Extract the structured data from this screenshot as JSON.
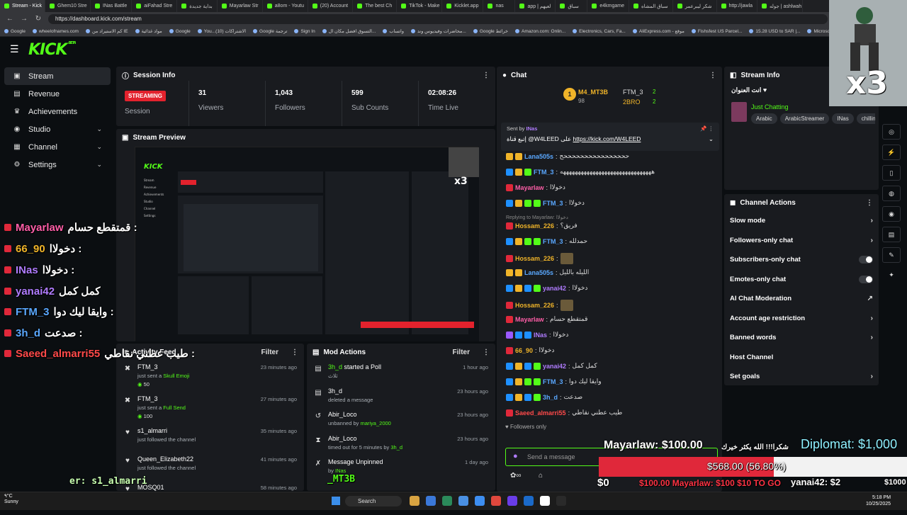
{
  "browser": {
    "tabs": [
      "Stream - Kick",
      "Ghem10 Stre",
      "INas Battle",
      "aiFahad Stre",
      "بداية جديدة",
      "Mayarlaw Str",
      "a8om - Youtu",
      "(20) Account",
      "The best Ch",
      "TikTok - Make",
      "Kicklet.app",
      "nas",
      "app | لعيهم",
      "سباق",
      "e4kmgame",
      "سباق المشاه",
      "شكر ليبرعمر",
      "http://jawla",
      "جوله | ashlwah"
    ],
    "url": "https://dashboard.kick.com/stream",
    "bookmarks": [
      "Google",
      "wheelofnames.com",
      "كم الاستيراد من IE",
      "مواد غذائية",
      "Google",
      "You...الاشتراكات (10)",
      "Google ترجمة",
      "Sign In",
      "التسوق افضل مكان ال...",
      "واتساب",
      "محاضرات وفيديوس وند...",
      "Google خرائط",
      "Amazon.com: Onlin...",
      "Electronics, Cars, Fa...",
      "AliExpress.com - موقع",
      "Fishsfest US Parcel...",
      "15.28 USD to SAR |...",
      "Microsoft Learning"
    ]
  },
  "kick": {
    "logo": "KICK",
    "logo_sup": "BETA",
    "sidebar": [
      {
        "label": "Stream",
        "icon": "▣",
        "expand": ""
      },
      {
        "label": "Revenue",
        "icon": "▤",
        "expand": ""
      },
      {
        "label": "Achievements",
        "icon": "♛",
        "expand": ""
      },
      {
        "label": "Studio",
        "icon": "◉",
        "expand": "⌄"
      },
      {
        "label": "Channel",
        "icon": "▦",
        "expand": "⌄"
      },
      {
        "label": "Settings",
        "icon": "⚙",
        "expand": "⌄"
      }
    ]
  },
  "session": {
    "title": "Session Info",
    "status": "STREAMING",
    "status_label": "Session",
    "stats": [
      {
        "value": "31",
        "label": "Viewers"
      },
      {
        "value": "1,043",
        "label": "Followers"
      },
      {
        "value": "599",
        "label": "Sub Counts"
      },
      {
        "value": "02:08:26",
        "label": "Time Live"
      }
    ]
  },
  "preview": {
    "title": "Stream Preview"
  },
  "activity": {
    "title": "Activity Feed",
    "filter": "Filter",
    "items": [
      {
        "name": "FTM_3",
        "text": "just sent a ",
        "hl": "Skull Emoji",
        "amount": "50",
        "time": "23 minutes ago",
        "icon": "✖"
      },
      {
        "name": "FTM_3",
        "text": "just sent a ",
        "hl": "Full Send",
        "amount": "100",
        "time": "27 minutes ago",
        "icon": "✖"
      },
      {
        "name": "s1_almarri",
        "text": "just followed the channel",
        "hl": "",
        "amount": "",
        "time": "35 minutes ago",
        "icon": "♥"
      },
      {
        "name": "Queen_Elizabeth22",
        "text": "just followed the channel",
        "hl": "",
        "amount": "",
        "time": "41 minutes ago",
        "icon": "♥"
      },
      {
        "name": "MOSQ01",
        "text": "",
        "hl": "",
        "amount": "",
        "time": "58 minutes ago",
        "icon": "♥"
      }
    ]
  },
  "mod": {
    "title": "Mod Actions",
    "filter": "Filter",
    "items": [
      {
        "name": "3h_d",
        "action": " started a Poll",
        "sub": "ثلاث",
        "by": "",
        "time": "1 hour ago",
        "icon": "▤"
      },
      {
        "name": "3h_d",
        "action": "",
        "sub": "deleted a message",
        "by": "",
        "time": "23 hours ago",
        "icon": "▤"
      },
      {
        "name": "Abir_Loco",
        "action": "",
        "sub": "unbanned by ",
        "by": "mariya_2000",
        "time": "23 hours ago",
        "icon": "↺"
      },
      {
        "name": "Abir_Loco",
        "action": "",
        "sub": "timed out for 5 minutes by ",
        "by": "3h_d",
        "time": "23 hours ago",
        "icon": "⧗"
      },
      {
        "name": "Message Unpinned",
        "action": "",
        "sub": "by ",
        "by": "INas",
        "time": "1 day ago",
        "icon": "✗"
      }
    ]
  },
  "chat": {
    "title": "Chat",
    "leaders": [
      {
        "name": "M4_MT3B",
        "value": "98"
      },
      {
        "name": "FTM_3",
        "value": "2"
      },
      {
        "name": "2BRO",
        "value": "2"
      }
    ],
    "pinned_sent_by": "Sent by",
    "pinned_user": "INas",
    "pinned_text": "إتبع قناة @W4LEED على ",
    "pinned_link": "https://kick.com/W4LEED",
    "messages": [
      {
        "user": "Lana505s",
        "text": "ححححححححححححححححح",
        "cls": "u-blue",
        "badges": [
          "b-gold",
          "b-gold"
        ]
      },
      {
        "user": "FTM_3",
        "text": "هههههههههههههههههههههههههههههههه",
        "cls": "u-blue",
        "badges": [
          "b-blue",
          "b-gold",
          "b-green"
        ]
      },
      {
        "user": "Mayarlaw",
        "text": "دخولاا",
        "cls": "u-pink",
        "badges": [
          "b-red"
        ]
      },
      {
        "user": "FTM_3",
        "text": "دخولاا",
        "cls": "u-blue",
        "badges": [
          "b-blue",
          "b-gold",
          "b-green",
          "b-green"
        ]
      },
      {
        "user": "Hossam_226",
        "text": "فريق؟",
        "cls": "u-gold",
        "badges": [
          "b-red"
        ],
        "reply": "Replying to Mayarlaw: دخولاا"
      },
      {
        "user": "FTM_3",
        "text": "حمدلله",
        "cls": "u-blue",
        "badges": [
          "b-blue",
          "b-gold",
          "b-green",
          "b-green"
        ]
      },
      {
        "user": "Hossam_226",
        "text": "",
        "cls": "u-gold",
        "badges": [
          "b-red"
        ]
      },
      {
        "user": "Lana505s",
        "text": "الليله بالليل",
        "cls": "u-blue",
        "badges": [
          "b-gold",
          "b-gold"
        ]
      },
      {
        "user": "yanai42",
        "text": "دخولاا",
        "cls": "u-purple",
        "badges": [
          "b-blue",
          "b-gold",
          "b-blue",
          "b-green"
        ]
      },
      {
        "user": "Hossam_226",
        "text": "",
        "cls": "u-gold",
        "badges": [
          "b-red"
        ]
      },
      {
        "user": "Mayarlaw",
        "text": "قمتقطع حسام",
        "cls": "u-pink",
        "badges": [
          "b-red"
        ]
      },
      {
        "user": "INas",
        "text": "دخولاا",
        "cls": "u-purple",
        "badges": [
          "b-purple",
          "b-blue",
          "b-blue"
        ]
      },
      {
        "user": "66_90",
        "text": "دخولاا",
        "cls": "u-gold",
        "badges": [
          "b-red"
        ]
      },
      {
        "user": "yanai42",
        "text": "كمل كمل",
        "cls": "u-purple",
        "badges": [
          "b-blue",
          "b-gold",
          "b-blue",
          "b-green"
        ]
      },
      {
        "user": "FTM_3",
        "text": "وايقا ليك دوا",
        "cls": "u-blue",
        "badges": [
          "b-blue",
          "b-gold",
          "b-green",
          "b-green"
        ]
      },
      {
        "user": "3h_d",
        "text": "صدعت",
        "cls": "u-blue",
        "badges": [
          "b-blue",
          "b-gold",
          "b-blue",
          "b-green"
        ]
      },
      {
        "user": "Saeed_almarri55",
        "text": "طيب عطني نقاطي",
        "cls": "u-red",
        "badges": [
          "b-red"
        ]
      }
    ],
    "followers_only": "Followers only",
    "input_placeholder": "Send a message"
  },
  "stream_info": {
    "title": "Stream Info",
    "stream_title": "انت العنوان",
    "category": "Just Chatting",
    "tags": [
      "Arabic",
      "ArabicStreamer",
      "INas",
      "chillin"
    ]
  },
  "channel_actions": {
    "title": "Channel Actions",
    "items": [
      {
        "label": "Slow mode",
        "ctrl": "›"
      },
      {
        "label": "Followers-only chat",
        "ctrl": "›"
      },
      {
        "label": "Subscribers-only chat",
        "ctrl": "toggle"
      },
      {
        "label": "Emotes-only chat",
        "ctrl": "toggle"
      },
      {
        "label": "AI Chat Moderation",
        "ctrl": "↗"
      },
      {
        "label": "Account age restriction",
        "ctrl": "›"
      },
      {
        "label": "Banned words",
        "ctrl": "›"
      },
      {
        "label": "Host Channel",
        "ctrl": ""
      },
      {
        "label": "Set goals",
        "ctrl": "›"
      }
    ]
  },
  "overlay": {
    "multiplier": "x3",
    "chat_lines": [
      {
        "user": "Mayarlaw",
        "text": "قمتقطع حسام :",
        "color": "#ff5ea8"
      },
      {
        "user": "66_90",
        "text": "دخولاا :",
        "color": "#f0b429"
      },
      {
        "user": "INas",
        "text": "دخولاا :",
        "color": "#b07cff"
      },
      {
        "user": "yanai42",
        "text": "كمل كمل",
        "color": "#b07cff"
      },
      {
        "user": "FTM_3",
        "text": "وايقا ليك دوا :",
        "color": "#5aa8ff"
      },
      {
        "user": "3h_d",
        "text": "صدعت :",
        "color": "#5aa8ff"
      },
      {
        "user": "Saeed_almarri55",
        "text": "طيب عطني نقاطي :",
        "color": "#ff4a4a"
      }
    ],
    "follower_ticker": "er: s1_almarri",
    "donation_top": "Mayarlaw: $100.00",
    "donation_thanks": "شكرا!!! الله يكثر خيرك",
    "diplomat": "Diplomat: $1,000",
    "goal_value": "$568.00 (56.80%)",
    "goal_progress": 0.568,
    "goal_left": "$0",
    "goal_right": "$1000",
    "bottom_donations": "$100.00  Mayarlaw: $100  $10 TO GO",
    "bottom_yanai": "yanai42: $2",
    "mt3b_label": "_MT3B"
  },
  "taskbar": {
    "weather_temp": "٩°C",
    "weather_label": "Sunny",
    "search": "Search",
    "time": "5:18 PM",
    "date": "10/25/2025"
  }
}
